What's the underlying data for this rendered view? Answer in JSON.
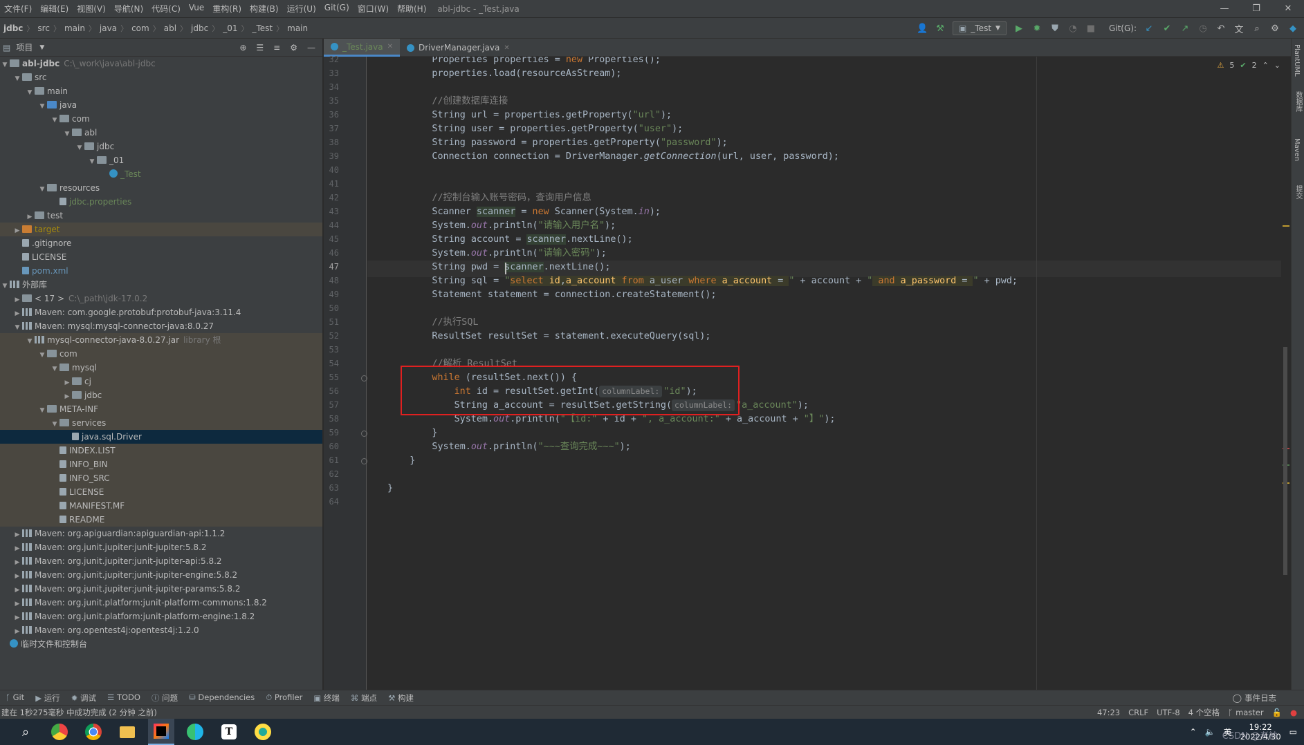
{
  "menubar": {
    "items": [
      "文件(F)",
      "编辑(E)",
      "视图(V)",
      "导航(N)",
      "代码(C)",
      "Vue",
      "重构(R)",
      "构建(B)",
      "运行(U)",
      "Git(G)",
      "窗口(W)",
      "帮助(H)"
    ],
    "window_title": "abl-jdbc - _Test.java"
  },
  "breadcrumb": [
    "jdbc",
    "src",
    "main",
    "java",
    "com",
    "abl",
    "jdbc",
    "_01",
    "_Test",
    "main"
  ],
  "toolbar": {
    "run_config": "_Test",
    "git_label": "Git(G):"
  },
  "project_panel": {
    "title": "项目"
  },
  "tree": [
    {
      "label": "abl-jdbc",
      "note": "C:\\_work\\java\\abl-jdbc",
      "indent": 0,
      "arrow": "▾",
      "icon": "folder",
      "bold": true
    },
    {
      "label": "src",
      "indent": 1,
      "arrow": "▾",
      "icon": "folder"
    },
    {
      "label": "main",
      "indent": 2,
      "arrow": "▾",
      "icon": "folder"
    },
    {
      "label": "java",
      "indent": 3,
      "arrow": "▾",
      "icon": "folder-blue"
    },
    {
      "label": "com",
      "indent": 4,
      "arrow": "▾",
      "icon": "folder"
    },
    {
      "label": "abl",
      "indent": 5,
      "arrow": "▾",
      "icon": "folder"
    },
    {
      "label": "jdbc",
      "indent": 6,
      "arrow": "▾",
      "icon": "folder"
    },
    {
      "label": "_01",
      "indent": 7,
      "arrow": "▾",
      "icon": "folder"
    },
    {
      "label": "_Test",
      "indent": 8,
      "arrow": "",
      "icon": "class",
      "color": "green"
    },
    {
      "label": "resources",
      "indent": 3,
      "arrow": "▾",
      "icon": "folder"
    },
    {
      "label": "jdbc.properties",
      "indent": 4,
      "arrow": "",
      "icon": "file",
      "color": "green"
    },
    {
      "label": "test",
      "indent": 2,
      "arrow": "▸",
      "icon": "folder"
    },
    {
      "label": "target",
      "indent": 1,
      "arrow": "▸",
      "icon": "folder-orange",
      "color": "olive",
      "ext": true
    },
    {
      "label": ".gitignore",
      "indent": 1,
      "arrow": "",
      "icon": "file"
    },
    {
      "label": "LICENSE",
      "indent": 1,
      "arrow": "",
      "icon": "file"
    },
    {
      "label": "pom.xml",
      "indent": 1,
      "arrow": "",
      "icon": "maven",
      "color": "blue"
    },
    {
      "label": "外部库",
      "indent": 0,
      "arrow": "▾",
      "icon": "lib"
    },
    {
      "label": "< 17 >",
      "note": "C:\\_path\\jdk-17.0.2",
      "indent": 1,
      "arrow": "▸",
      "icon": "folder"
    },
    {
      "label": "Maven: com.google.protobuf:protobuf-java:3.11.4",
      "indent": 1,
      "arrow": "▸",
      "icon": "lib"
    },
    {
      "label": "Maven: mysql:mysql-connector-java:8.0.27",
      "indent": 1,
      "arrow": "▾",
      "icon": "lib"
    },
    {
      "label": "mysql-connector-java-8.0.27.jar",
      "note": "library 根",
      "indent": 2,
      "arrow": "▾",
      "icon": "jar",
      "ext": true
    },
    {
      "label": "com",
      "indent": 3,
      "arrow": "▾",
      "icon": "folder",
      "ext": true
    },
    {
      "label": "mysql",
      "indent": 4,
      "arrow": "▾",
      "icon": "folder",
      "ext": true
    },
    {
      "label": "cj",
      "indent": 5,
      "arrow": "▸",
      "icon": "folder",
      "ext": true
    },
    {
      "label": "jdbc",
      "indent": 5,
      "arrow": "▸",
      "icon": "folder",
      "ext": true
    },
    {
      "label": "META-INF",
      "indent": 3,
      "arrow": "▾",
      "icon": "folder",
      "ext": true
    },
    {
      "label": "services",
      "indent": 4,
      "arrow": "▾",
      "icon": "folder",
      "ext": true
    },
    {
      "label": "java.sql.Driver",
      "indent": 5,
      "arrow": "",
      "icon": "file",
      "sel": true
    },
    {
      "label": "INDEX.LIST",
      "indent": 4,
      "arrow": "",
      "icon": "file",
      "ext": true
    },
    {
      "label": "INFO_BIN",
      "indent": 4,
      "arrow": "",
      "icon": "file",
      "ext": true
    },
    {
      "label": "INFO_SRC",
      "indent": 4,
      "arrow": "",
      "icon": "file",
      "ext": true
    },
    {
      "label": "LICENSE",
      "indent": 4,
      "arrow": "",
      "icon": "file",
      "ext": true
    },
    {
      "label": "MANIFEST.MF",
      "indent": 4,
      "arrow": "",
      "icon": "file",
      "ext": true
    },
    {
      "label": "README",
      "indent": 4,
      "arrow": "",
      "icon": "file",
      "ext": true
    },
    {
      "label": "Maven: org.apiguardian:apiguardian-api:1.1.2",
      "indent": 1,
      "arrow": "▸",
      "icon": "lib"
    },
    {
      "label": "Maven: org.junit.jupiter:junit-jupiter:5.8.2",
      "indent": 1,
      "arrow": "▸",
      "icon": "lib"
    },
    {
      "label": "Maven: org.junit.jupiter:junit-jupiter-api:5.8.2",
      "indent": 1,
      "arrow": "▸",
      "icon": "lib"
    },
    {
      "label": "Maven: org.junit.jupiter:junit-jupiter-engine:5.8.2",
      "indent": 1,
      "arrow": "▸",
      "icon": "lib"
    },
    {
      "label": "Maven: org.junit.jupiter:junit-jupiter-params:5.8.2",
      "indent": 1,
      "arrow": "▸",
      "icon": "lib"
    },
    {
      "label": "Maven: org.junit.platform:junit-platform-commons:1.8.2",
      "indent": 1,
      "arrow": "▸",
      "icon": "lib"
    },
    {
      "label": "Maven: org.junit.platform:junit-platform-engine:1.8.2",
      "indent": 1,
      "arrow": "▸",
      "icon": "lib"
    },
    {
      "label": "Maven: org.opentest4j:opentest4j:1.2.0",
      "indent": 1,
      "arrow": "▸",
      "icon": "lib"
    },
    {
      "label": "临时文件和控制台",
      "indent": 0,
      "arrow": "",
      "icon": "scratch"
    }
  ],
  "tabs": [
    {
      "label": "_Test.java",
      "active": true
    },
    {
      "label": "DriverManager.java",
      "active": false
    }
  ],
  "inspection": {
    "warnings": "5",
    "weak": "2"
  },
  "code": {
    "current_line": 47,
    "lines": [
      {
        "n": 32,
        "indent": 8,
        "tokens": [
          [
            "t",
            "Properties properties = "
          ],
          [
            "kw",
            "new "
          ],
          [
            "t",
            "Properties();"
          ]
        ]
      },
      {
        "n": 33,
        "indent": 8,
        "tokens": [
          [
            "t",
            "properties.load(resourceAsStream);"
          ]
        ]
      },
      {
        "n": 34,
        "indent": 0,
        "tokens": []
      },
      {
        "n": 35,
        "indent": 8,
        "tokens": [
          [
            "cm",
            "//创建数据库连接"
          ]
        ]
      },
      {
        "n": 36,
        "indent": 8,
        "tokens": [
          [
            "t",
            "String url = properties.getProperty("
          ],
          [
            "str",
            "\"url\""
          ],
          [
            "t",
            ");"
          ]
        ]
      },
      {
        "n": 37,
        "indent": 8,
        "tokens": [
          [
            "t",
            "String user = properties.getProperty("
          ],
          [
            "str",
            "\"user\""
          ],
          [
            "t",
            ");"
          ]
        ]
      },
      {
        "n": 38,
        "indent": 8,
        "tokens": [
          [
            "t",
            "String password = properties.getProperty("
          ],
          [
            "str",
            "\"password\""
          ],
          [
            "t",
            ");"
          ]
        ]
      },
      {
        "n": 39,
        "indent": 8,
        "tokens": [
          [
            "t",
            "Connection connection = DriverManager."
          ],
          [
            "mth",
            "getConnection"
          ],
          [
            "t",
            "(url, user, password);"
          ]
        ]
      },
      {
        "n": 40,
        "indent": 0,
        "tokens": []
      },
      {
        "n": 41,
        "indent": 0,
        "tokens": []
      },
      {
        "n": 42,
        "indent": 8,
        "tokens": [
          [
            "cm",
            "//控制台输入账号密码，查询用户信息"
          ]
        ]
      },
      {
        "n": 43,
        "indent": 8,
        "tokens": [
          [
            "t",
            "Scanner "
          ],
          [
            "hl",
            "scanner"
          ],
          [
            "t",
            " = "
          ],
          [
            "kw",
            "new "
          ],
          [
            "t",
            "Scanner(System."
          ],
          [
            "fld",
            "in"
          ],
          [
            "t",
            ");"
          ]
        ]
      },
      {
        "n": 44,
        "indent": 8,
        "tokens": [
          [
            "t",
            "System."
          ],
          [
            "fld",
            "out"
          ],
          [
            "t",
            ".println("
          ],
          [
            "str",
            "\"请输入用户名\""
          ],
          [
            "t",
            ");"
          ]
        ]
      },
      {
        "n": 45,
        "indent": 8,
        "tokens": [
          [
            "t",
            "String account = "
          ],
          [
            "hl",
            "scanner"
          ],
          [
            "t",
            ".nextLine();"
          ]
        ]
      },
      {
        "n": 46,
        "indent": 8,
        "tokens": [
          [
            "t",
            "System."
          ],
          [
            "fld",
            "out"
          ],
          [
            "t",
            ".println("
          ],
          [
            "str",
            "\"请输入密码\""
          ],
          [
            "t",
            ");"
          ]
        ]
      },
      {
        "n": 47,
        "indent": 8,
        "tokens": [
          [
            "t",
            "String pwd = "
          ],
          [
            "hl",
            "scanner"
          ],
          [
            "t",
            ".nextLine();"
          ]
        ]
      },
      {
        "n": 48,
        "indent": 8,
        "tokens": [
          [
            "t",
            "String sql = "
          ],
          [
            "str",
            "\""
          ],
          [
            "sqlkw",
            "select "
          ],
          [
            "sqlid",
            "id"
          ],
          [
            "sqlt",
            ","
          ],
          [
            "sqlid",
            "a_account "
          ],
          [
            "sqlkw",
            "from "
          ],
          [
            "sqlt",
            "a_user "
          ],
          [
            "sqlkw",
            "where "
          ],
          [
            "sqlid",
            "a_account "
          ],
          [
            "sqlt",
            "= "
          ],
          [
            "str",
            "\""
          ],
          [
            "t",
            " + account + "
          ],
          [
            "str",
            "\""
          ],
          [
            "sqlkw",
            " and "
          ],
          [
            "sqlid",
            "a_password "
          ],
          [
            "sqlt",
            "= "
          ],
          [
            "str",
            "\""
          ],
          [
            "t",
            " + pwd;"
          ]
        ]
      },
      {
        "n": 49,
        "indent": 8,
        "tokens": [
          [
            "t",
            "Statement statement = connection.createStatement();"
          ]
        ]
      },
      {
        "n": 50,
        "indent": 0,
        "tokens": []
      },
      {
        "n": 51,
        "indent": 8,
        "tokens": [
          [
            "cm",
            "//执行SQL"
          ]
        ]
      },
      {
        "n": 52,
        "indent": 8,
        "tokens": [
          [
            "t",
            "ResultSet resultSet = statement.executeQuery(sql);"
          ]
        ]
      },
      {
        "n": 53,
        "indent": 0,
        "tokens": []
      },
      {
        "n": 54,
        "indent": 8,
        "tokens": [
          [
            "cm",
            "//解析 ResultSet"
          ]
        ]
      },
      {
        "n": 55,
        "indent": 8,
        "tokens": [
          [
            "kw",
            "while "
          ],
          [
            "t",
            "(resultSet.next()) {"
          ]
        ]
      },
      {
        "n": 56,
        "indent": 12,
        "tokens": [
          [
            "kw",
            "int "
          ],
          [
            "t",
            "id = resultSet.getInt("
          ],
          [
            "hint",
            "columnLabel:"
          ],
          [
            "str",
            "\"id\""
          ],
          [
            "t",
            ");"
          ]
        ]
      },
      {
        "n": 57,
        "indent": 12,
        "tokens": [
          [
            "t",
            "String a_account = resultSet.getString("
          ],
          [
            "hint",
            "columnLabel:"
          ],
          [
            "str",
            "\"a_account\""
          ],
          [
            "t",
            ");"
          ]
        ]
      },
      {
        "n": 58,
        "indent": 12,
        "tokens": [
          [
            "t",
            "System."
          ],
          [
            "fld",
            "out"
          ],
          [
            "t",
            ".println("
          ],
          [
            "str",
            "\"【id:\""
          ],
          [
            "t",
            " + id + "
          ],
          [
            "str",
            "\", a_account:\""
          ],
          [
            "t",
            " + a_account + "
          ],
          [
            "str",
            "\"】\""
          ],
          [
            "t",
            ");"
          ]
        ]
      },
      {
        "n": 59,
        "indent": 8,
        "tokens": [
          [
            "t",
            "}"
          ]
        ]
      },
      {
        "n": 60,
        "indent": 8,
        "tokens": [
          [
            "t",
            "System."
          ],
          [
            "fld",
            "out"
          ],
          [
            "t",
            ".println("
          ],
          [
            "str",
            "\"~~~查询完成~~~\""
          ],
          [
            "t",
            ");"
          ]
        ]
      },
      {
        "n": 61,
        "indent": 4,
        "tokens": [
          [
            "t",
            "}"
          ]
        ]
      },
      {
        "n": 62,
        "indent": 0,
        "tokens": []
      },
      {
        "n": 63,
        "indent": 0,
        "tokens": [
          [
            "t",
            "}"
          ]
        ]
      },
      {
        "n": 64,
        "indent": 0,
        "tokens": []
      }
    ]
  },
  "right_tools": [
    "PlantUML",
    "数据库",
    "Maven",
    "提交"
  ],
  "bottom_tools": [
    "Git",
    "运行",
    "调试",
    "TODO",
    "问题",
    "Dependencies",
    "Profiler",
    "终端",
    "端点",
    "构建"
  ],
  "bottom_right_tool": "事件日志",
  "status": {
    "message": "建在 1秒275毫秒 中成功完成 (2 分钟 之前)",
    "position": "47:23",
    "line_sep": "CRLF",
    "encoding": "UTF-8",
    "indent": "4 个空格",
    "branch": "master"
  },
  "taskbar": {
    "tray_lang": "英",
    "time": "19:22",
    "date": "2022/4/30",
    "watermark": "CSDN @老衲"
  }
}
